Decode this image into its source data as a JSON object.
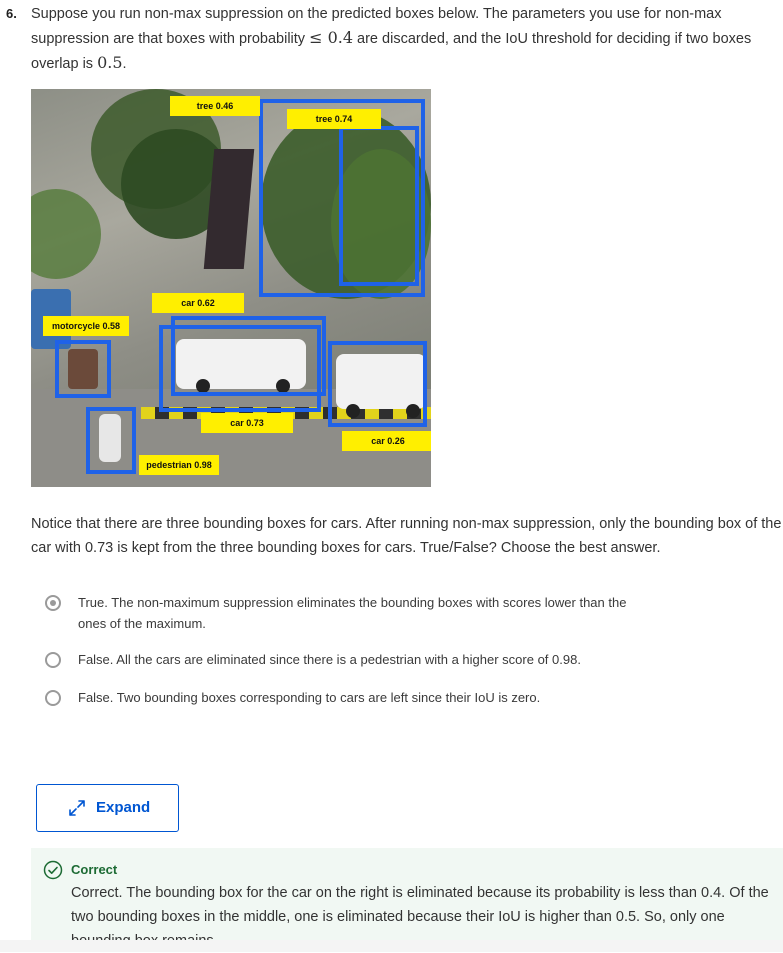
{
  "question": {
    "number": "6.",
    "text_part1": "Suppose you run non-max suppression on the predicted boxes below. The parameters you use for non-max suppression are that boxes with probability ",
    "math1": "≤ 0.4",
    "text_part2": " are discarded, and the IoU threshold for deciding if two boxes overlap is ",
    "math2": "0.5",
    "text_part3": "."
  },
  "image": {
    "labels": {
      "tree_046": "tree 0.46",
      "tree_074": "tree 0.74",
      "car_062": "car 0.62",
      "motorcycle_058": "motorcycle 0.58",
      "car_073": "car 0.73",
      "car_026": "car 0.26",
      "pedestrian_098": "pedestrian 0.98"
    },
    "box_color": "#1f62e8",
    "label_color": "#ffef00"
  },
  "notice": "Notice that there are three bounding boxes for cars. After running non-max suppression, only the bounding box of the car with 0.73 is kept from the three bounding boxes for cars. True/False? Choose the best answer.",
  "options": [
    {
      "text": "True. The non-maximum suppression eliminates the bounding boxes with scores lower than the ones of the maximum.",
      "selected": true
    },
    {
      "text": "False. All the cars are eliminated since there is a pedestrian with a higher score of 0.98.",
      "selected": false
    },
    {
      "text": "False. Two bounding boxes corresponding to cars are left since their IoU is zero.",
      "selected": false
    }
  ],
  "expand": {
    "label": "Expand",
    "icon": "expand-arrows-icon"
  },
  "feedback": {
    "title": "Correct",
    "text": "Correct. The bounding box for the car on the right is eliminated because its probability is less than 0.4. Of the two bounding boxes in the middle, one is eliminated because their IoU is higher than 0.5. So, only one bounding box remains.",
    "color": "#1d6b34"
  }
}
